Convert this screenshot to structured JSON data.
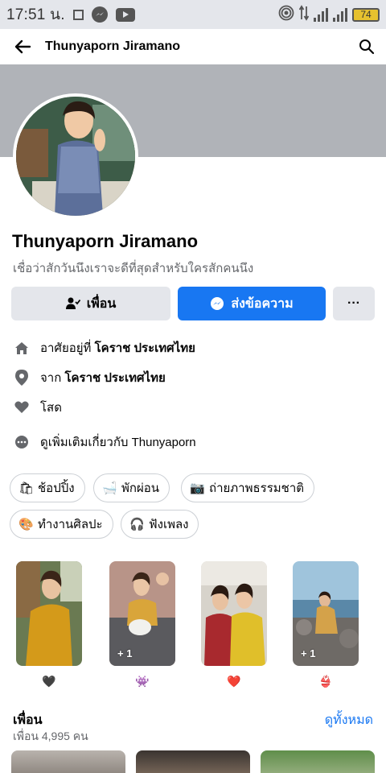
{
  "status_bar": {
    "time": "17:51 น.",
    "battery": "74",
    "icons": [
      "square-icon",
      "messenger-icon",
      "youtube-icon",
      "hotspot-icon",
      "signal-icon",
      "wifi-icon"
    ]
  },
  "header": {
    "title": "Thunyaporn Jiramano",
    "back_icon": "arrow-left-icon",
    "search_icon": "search-icon"
  },
  "profile": {
    "name": "Thunyaporn Jiramano",
    "bio": "เชื่อว่าสักวันนึงเราจะดีที่สุดสำหรับใครสักคนนึง"
  },
  "actions": {
    "friend_label": "เพื่อน",
    "message_label": "ส่งข้อความ",
    "more_label": "···"
  },
  "info": {
    "lives_prefix": "อาศัยอยู่ที่ ",
    "lives_value": "โคราช ประเทศไทย",
    "from_prefix": "จาก ",
    "from_value": "โคราช ประเทศไทย",
    "relationship": "โสด",
    "see_more": "ดูเพิ่มเติมเกี่ยวกับ Thunyaporn"
  },
  "hobbies": [
    {
      "label": "ช้อปปิ้ง",
      "emoji": "🛍"
    },
    {
      "label": "พักผ่อน",
      "emoji": "🛁"
    },
    {
      "label": "ถ่ายภาพธรรมชาติ",
      "emoji": "📷"
    },
    {
      "label": "ทำงานศิลปะ",
      "emoji": "🎨"
    },
    {
      "label": "ฟังเพลง",
      "emoji": "🎧"
    }
  ],
  "featured": [
    {
      "count": "",
      "reaction": "🖤"
    },
    {
      "count": "+ 1",
      "reaction": "👾"
    },
    {
      "count": "",
      "reaction": "❤️"
    },
    {
      "count": "+ 1",
      "reaction": "👙"
    }
  ],
  "friends": {
    "title": "เพื่อน",
    "count": "เพื่อน 4,995 คน",
    "see_all": "ดูทั้งหมด"
  },
  "colors": {
    "accent": "#1877f2",
    "cover": "#b0b3b8",
    "button_gray": "#e4e6eb",
    "secondary_text": "#65676b"
  }
}
